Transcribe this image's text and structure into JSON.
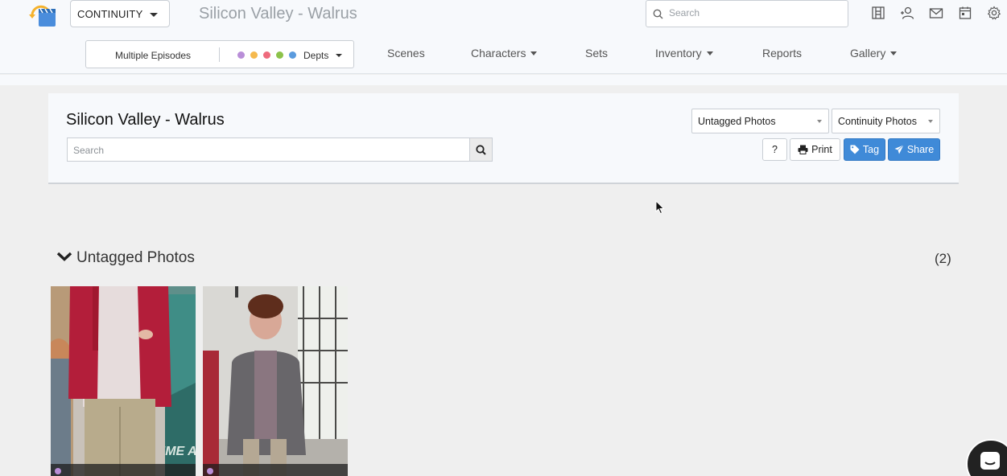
{
  "header": {
    "app_selector": "CONTINUITY",
    "project_title": "Silicon Valley - Walrus",
    "search_placeholder": "Search",
    "icons": [
      "breakdown-icon",
      "add-user-icon",
      "mail-icon",
      "calendar-icon",
      "settings-icon"
    ]
  },
  "filters": {
    "episodes": "Multiple Episodes",
    "dept_colors": [
      "#b98ed8",
      "#f5b94e",
      "#ee6b7d",
      "#8cc24a",
      "#5b9bde"
    ],
    "depts": "Depts"
  },
  "nav": {
    "items": [
      {
        "label": "Scenes"
      },
      {
        "label": "Characters"
      },
      {
        "label": "Sets"
      },
      {
        "label": "Inventory"
      },
      {
        "label": "Reports"
      },
      {
        "label": "Gallery"
      }
    ]
  },
  "panel": {
    "title": "Silicon Valley - Walrus",
    "search_placeholder": "Search",
    "filter_select": "Untagged Photos",
    "type_select": "Continuity Photos",
    "help_label": "?",
    "print_label": "Print",
    "tag_label": "Tag",
    "share_label": "Share"
  },
  "section": {
    "title": "Untagged Photos",
    "count": "(2)"
  },
  "photos": [
    {
      "dept_color": "#b98ed8"
    },
    {
      "dept_color": "#b98ed8"
    }
  ],
  "colors": {
    "accent": "#3f8ad8",
    "page_bg": "#efefef",
    "header_bg": "#f7f9fc"
  }
}
